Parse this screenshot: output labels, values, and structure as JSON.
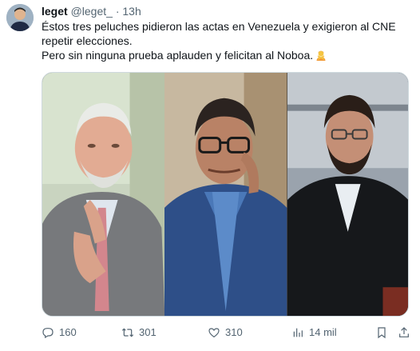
{
  "tweet": {
    "display_name": "leget",
    "handle": "@leget_",
    "separator": "·",
    "time": "13h",
    "lines": [
      "Éstos tres peluches pidieron las actas en Venezuela y exigieron al CNE",
      "repetir elecciones.",
      "Pero sin ninguna prueba aplauden y felicitan al Noboa."
    ],
    "emoji_icon": "person-gesturing-no-icon"
  },
  "actions": {
    "replies": "160",
    "reposts": "301",
    "likes": "310",
    "views": "14 mil"
  },
  "icons": {
    "reply": "reply-icon",
    "repost": "repost-icon",
    "like": "heart-icon",
    "views": "views-chart-icon",
    "bookmark": "bookmark-icon",
    "share": "share-icon"
  },
  "colors": {
    "text": "#0f1419",
    "muted": "#536471",
    "border": "#cfd9de"
  }
}
